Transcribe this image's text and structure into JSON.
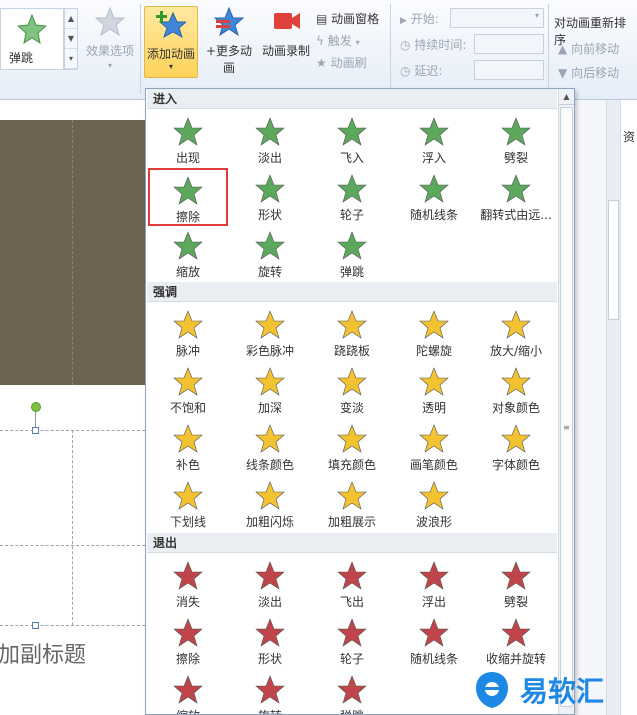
{
  "ribbon": {
    "effect_gallery_label": "弹跳",
    "effect_options": "效果选项",
    "add_animation": "添加动画",
    "more_animations": "+更多动画",
    "record_animation": "动画录制",
    "animation_pane": "动画窗格",
    "trigger": "触发",
    "animation_painter": "动画刷",
    "start_label": "开始:",
    "duration_label": "持续时间:",
    "delay_label": "延迟:",
    "reorder_title": "对动画重新排序",
    "move_earlier": "向前移动",
    "move_later": "向后移动"
  },
  "slide": {
    "subtitle_placeholder": "加副标题"
  },
  "side_panel": {
    "text": "资"
  },
  "menu": {
    "sections": [
      {
        "title": "进入",
        "color": "#5ca85c",
        "items": [
          "出现",
          "淡出",
          "飞入",
          "浮入",
          "劈裂",
          "擦除",
          "形状",
          "轮子",
          "随机线条",
          "翻转式由远...",
          "缩放",
          "旋转",
          "弹跳"
        ],
        "selected": "擦除"
      },
      {
        "title": "强调",
        "color": "#f2c230",
        "items": [
          "脉冲",
          "彩色脉冲",
          "跷跷板",
          "陀螺旋",
          "放大/缩小",
          "不饱和",
          "加深",
          "变淡",
          "透明",
          "对象颜色",
          "补色",
          "线条颜色",
          "填充颜色",
          "画笔颜色",
          "字体颜色",
          "下划线",
          "加粗闪烁",
          "加粗展示",
          "波浪形"
        ]
      },
      {
        "title": "退出",
        "color": "#c0454a",
        "items": [
          "消失",
          "淡出",
          "飞出",
          "浮出",
          "劈裂",
          "擦除",
          "形状",
          "轮子",
          "随机线条",
          "收缩并旋转",
          "缩放",
          "旋转",
          "弹跳"
        ]
      }
    ]
  },
  "watermark": {
    "text": "易软汇"
  }
}
